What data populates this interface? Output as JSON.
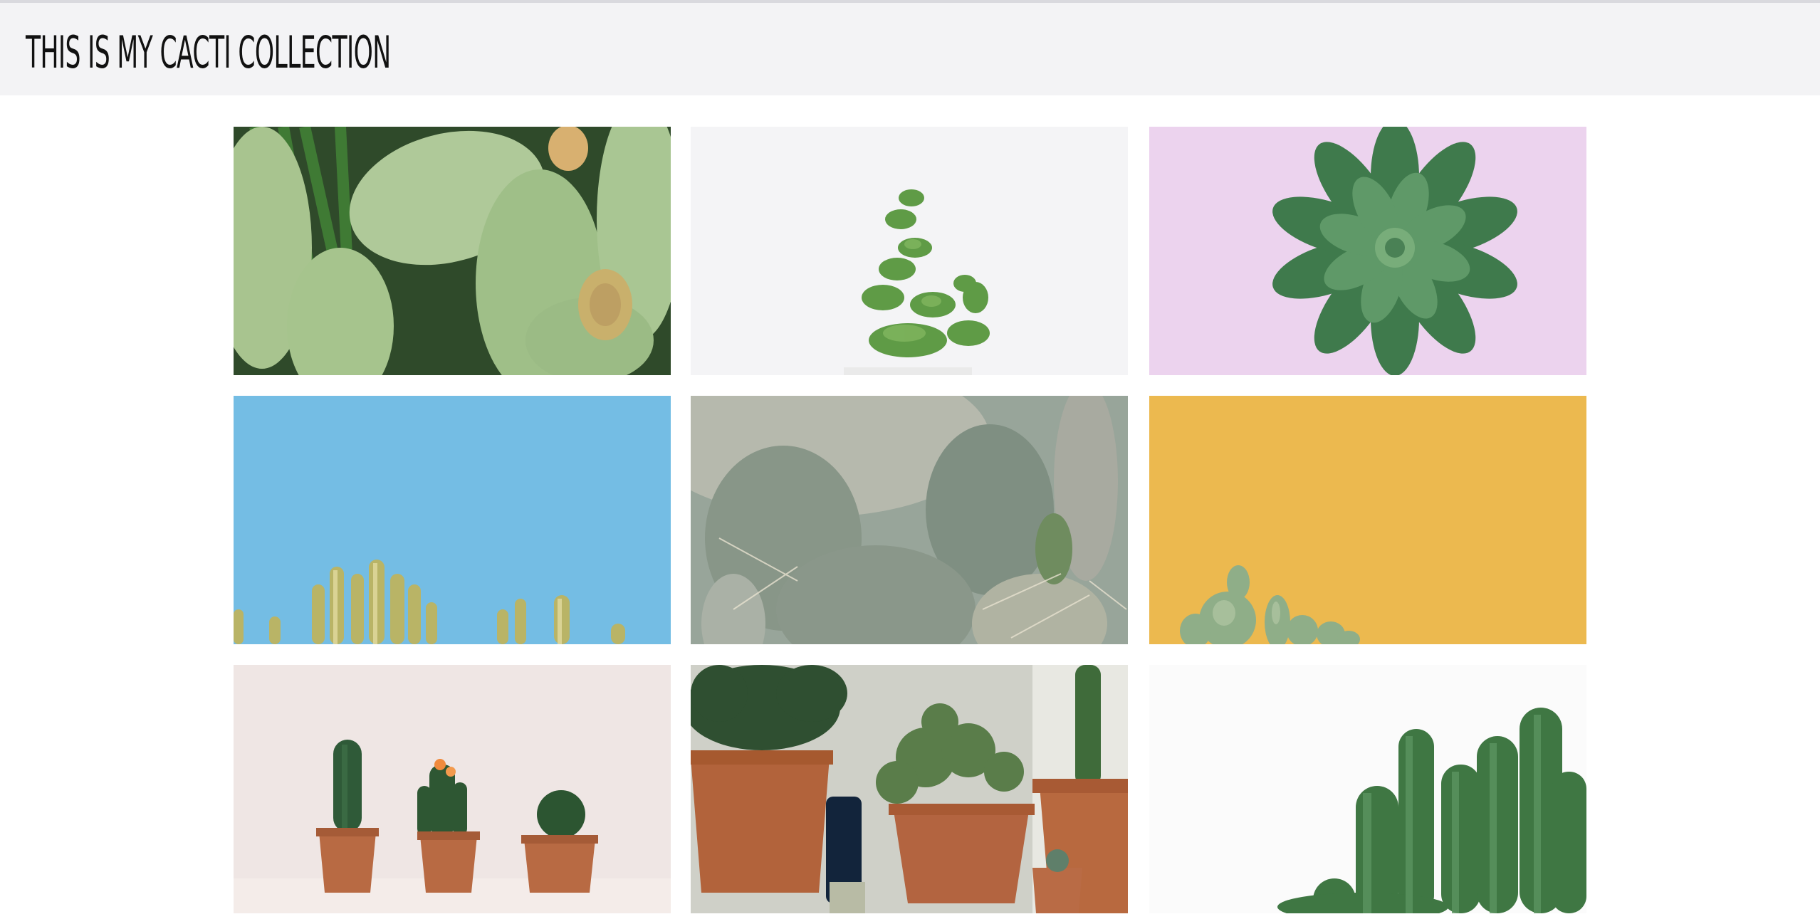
{
  "header": {
    "title": "THIS IS MY CACTI COLLECTION"
  },
  "gallery": {
    "photos": [
      {
        "subject": "prickly pear cactus pads with fruit",
        "background": "#c9d9b4"
      },
      {
        "subject": "small jade succulent in white pot",
        "background": "#f4f4f6"
      },
      {
        "subject": "green rosette succulent on lilac",
        "background": "#ecd3ee"
      },
      {
        "subject": "cactus tips against blue sky",
        "background": "#74bde4"
      },
      {
        "subject": "hazy cactus garden",
        "background": "#98a59a"
      },
      {
        "subject": "small cacti on mustard yellow",
        "background": "#ecb94f"
      },
      {
        "subject": "three potted cacti on pink",
        "background": "#efe6e4"
      },
      {
        "subject": "terracotta pots with cacti and jade",
        "background": "#cfd0c8"
      },
      {
        "subject": "cluster of columnar cacti on white",
        "background": "#fbfbfb"
      }
    ]
  }
}
